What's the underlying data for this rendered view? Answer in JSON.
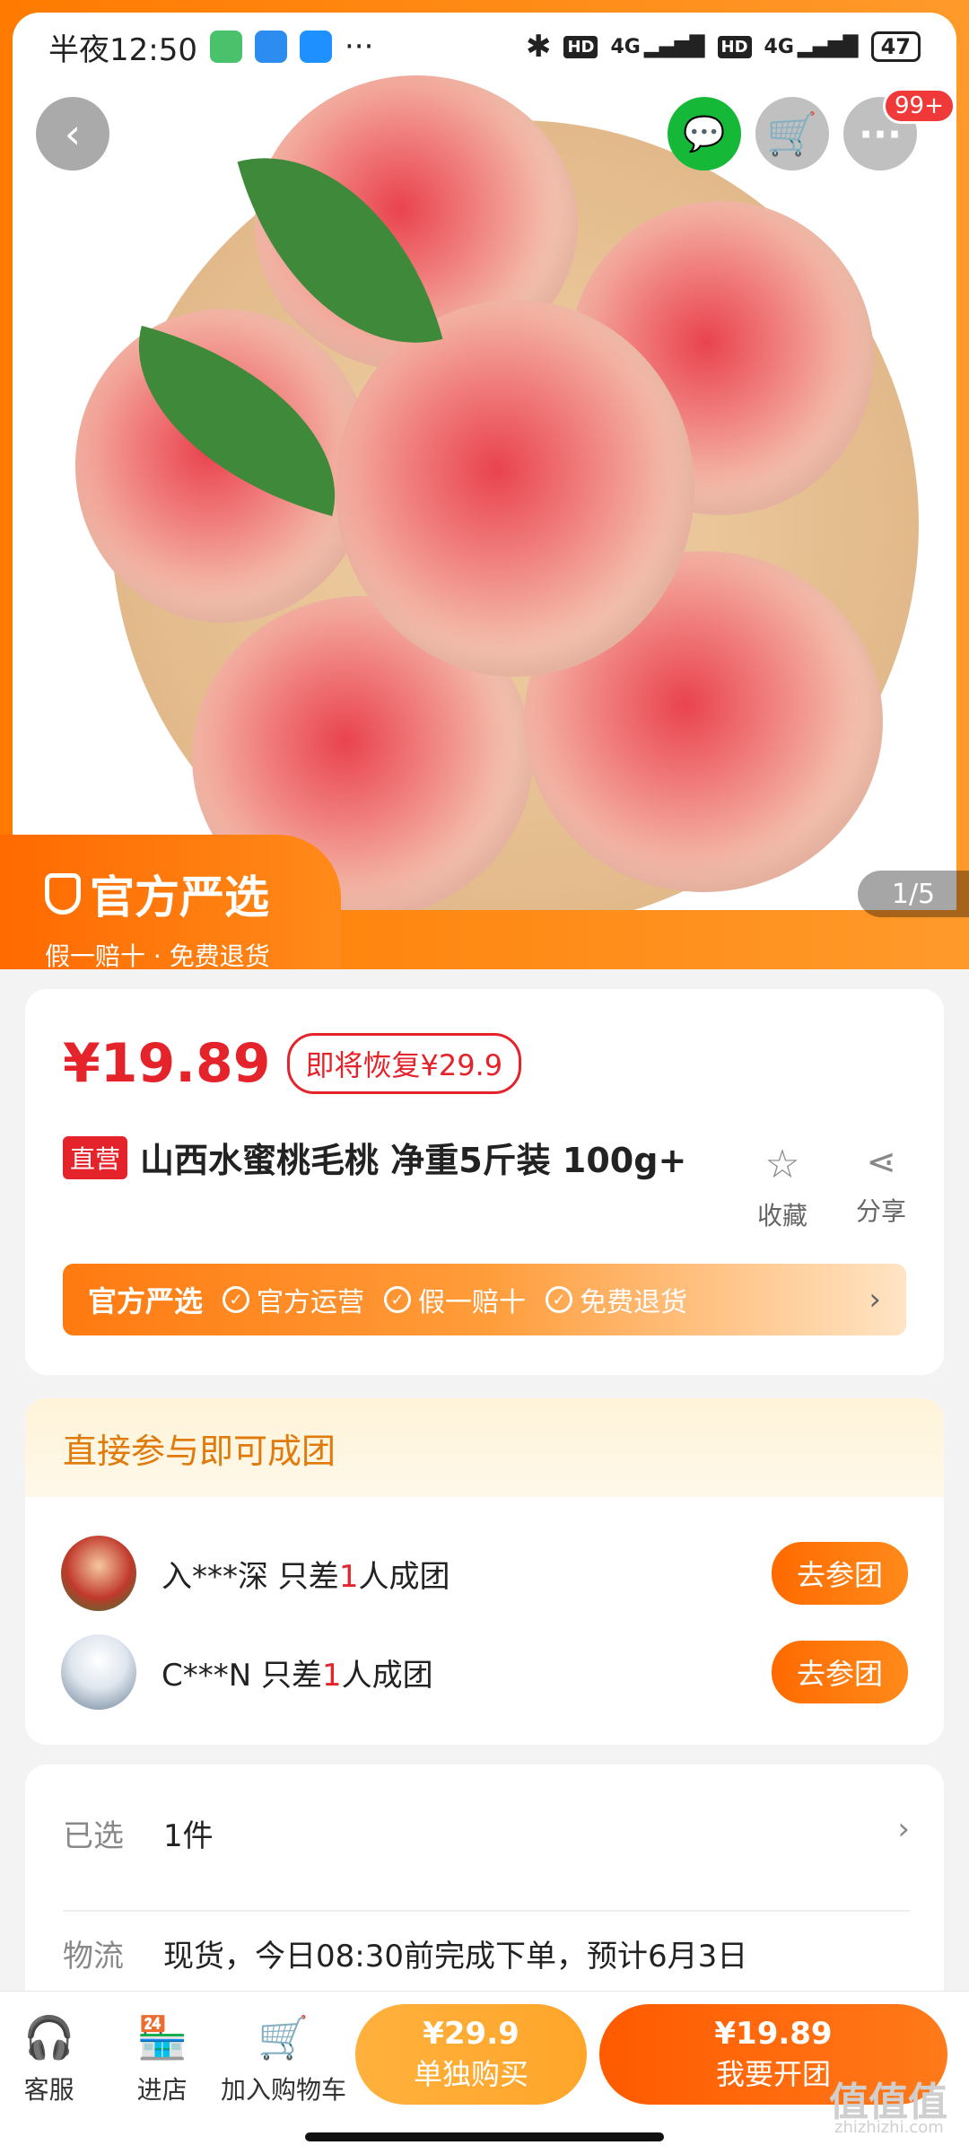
{
  "status_bar": {
    "time": "半夜12:50",
    "more": "···",
    "network1": "4G",
    "network2": "4G",
    "hd": "HD",
    "battery": "47"
  },
  "hero": {
    "brand_title": "官方严选",
    "brand_subtitle": "假一赔十 · 免费退货",
    "pager": "1/5",
    "cart_badge": "99+"
  },
  "product": {
    "price": "¥19.89",
    "restore_text": "即将恢复¥29.9",
    "self_tag": "直营",
    "title": "山西水蜜桃毛桃 净重5斤装 100g+",
    "fav_label": "收藏",
    "share_label": "分享"
  },
  "official_bar": {
    "title": "官方严选",
    "items": [
      "官方运营",
      "假一赔十",
      "免费退货"
    ]
  },
  "group": {
    "header": "直接参与即可成团",
    "rows": [
      {
        "name": "入***深",
        "prefix": " 只差",
        "count": "1",
        "suffix": "人成团",
        "button": "去参团"
      },
      {
        "name": "C***N",
        "prefix": " 只差",
        "count": "1",
        "suffix": "人成团",
        "button": "去参团"
      }
    ]
  },
  "selection": {
    "selected_label": "已选",
    "selected_value": "1件",
    "logistics_label": "物流",
    "logistics_value": "现货，今日08:30前完成下单，预计6月3日"
  },
  "bottom_bar": {
    "cs_label": "客服",
    "shop_label": "进店",
    "cart_label": "加入购物车",
    "solo_price": "¥29.9",
    "solo_label": "单独购买",
    "group_price": "¥19.89",
    "group_label": "我要开团"
  },
  "watermark": {
    "text": "值值值",
    "url": "zhizhizhi.com"
  }
}
